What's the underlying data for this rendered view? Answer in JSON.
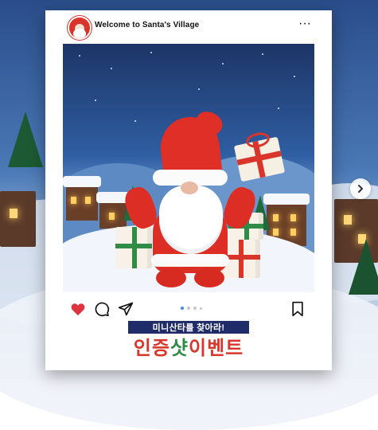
{
  "post": {
    "account_name": "Welcome to Santa's Village",
    "more_label": "···",
    "carousel": {
      "current_index": 1,
      "total": 4
    },
    "banner_text": "미니산타를 찾아라!",
    "headline": [
      {
        "text": "인증",
        "color": "#d9352b"
      },
      {
        "text": "샷",
        "color": "#2f8c47"
      },
      {
        "text": "이벤트",
        "color": "#d9352b"
      }
    ]
  },
  "icons": {
    "avatar": "santa-avatar",
    "more": "more-dots-icon",
    "like": "heart-icon",
    "comment": "comment-icon",
    "share": "paper-plane-icon",
    "save": "bookmark-icon",
    "next": "chevron-right-icon"
  },
  "colors": {
    "like_red": "#e0323e",
    "banner_navy": "#1f2c69",
    "active_dot": "#3a8ee6"
  }
}
